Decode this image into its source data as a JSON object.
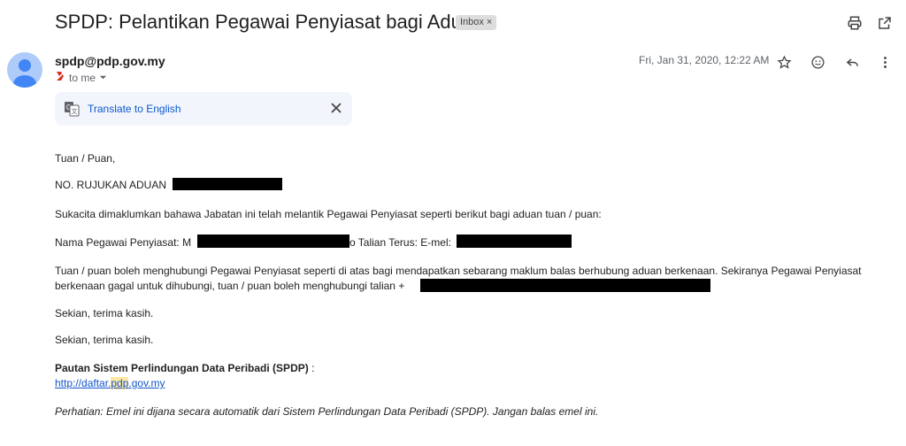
{
  "email": {
    "subject": "SPDP: Pelantikan Pegawai Penyiasat bagi Aduan",
    "label_chip": "Inbox",
    "label_chip_close": "×",
    "sender": "spdp@pdp.gov.my",
    "recipient": "to me",
    "date": "Fri, Jan 31, 2020, 12:22 AM",
    "translate_label": "Translate to English",
    "icons": {
      "print": "print-icon",
      "open_new": "open-in-new-icon",
      "star": "star-icon",
      "emoji": "emoji-icon",
      "reply": "reply-icon",
      "more": "more-vert-icon",
      "translate": "translate-icon",
      "close": "close-icon",
      "important": "important-marker-icon",
      "dropdown": "chevron-down-icon"
    },
    "body": {
      "greeting": "Tuan / Puan,",
      "ref_label": "NO. RUJUKAN ADUAN",
      "para1": "Sukacita dimaklumkan bahawa Jabatan ini telah melantik Pegawai Penyiasat seperti berikut bagi aduan tuan / puan:",
      "officer_prefix": "Nama Pegawai Penyiasat: M",
      "officer_mid": "o Talian Terus: E-mel:",
      "para2_line1": "Tuan / puan boleh menghubungi Pegawai Penyiasat seperti di atas bagi mendapatkan sebarang maklum balas berhubung aduan berkenaan. Sekiranya Pegawai Penyiasat",
      "para2_line2": "berkenaan gagal untuk dihubungi, tuan / puan boleh menghubungi talian +",
      "thanks1": "Sekian, terima kasih.",
      "thanks2": "Sekian, terima kasih.",
      "link_heading": "Pautan Sistem Perlindungan Data Peribadi (SPDP)",
      "link_heading_colon": " :",
      "link_part1": "http://daftar.",
      "link_part2": "pdp",
      "link_part3": ".gov.my",
      "notice": "Perhatian: Emel ini dijana secara automatik dari Sistem Perlindungan Data Peribadi (SPDP). Jangan balas emel ini."
    },
    "colors": {
      "link": "#1155cc",
      "translate_bg": "#f2f6fc",
      "avatar": "#aecbfa",
      "highlight": "#fce8a6"
    }
  }
}
